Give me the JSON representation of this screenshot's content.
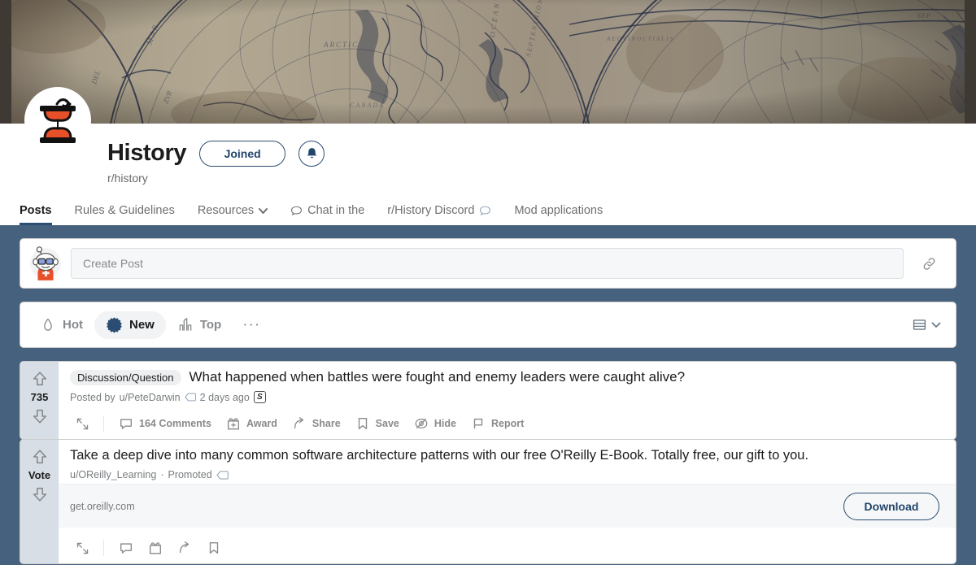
{
  "banner": {
    "alt": "antique world map banner"
  },
  "community": {
    "name": "History",
    "handle": "r/history",
    "join_label": "Joined",
    "notify_icon": "bell-icon",
    "avatar_icon": "hourglass-icon"
  },
  "tabs": [
    {
      "label": "Posts",
      "active": true,
      "icon": ""
    },
    {
      "label": "Rules & Guidelines",
      "active": false,
      "icon": ""
    },
    {
      "label": "Resources",
      "active": false,
      "icon": "chevron-down-icon"
    },
    {
      "label": "Chat in the",
      "active": false,
      "icon": "chat-bubble-icon",
      "icon_leading": true
    },
    {
      "label": "r/History Discord",
      "active": false,
      "icon": "chat-bubble-icon"
    },
    {
      "label": "Mod applications",
      "active": false,
      "icon": ""
    }
  ],
  "create_post": {
    "placeholder": "Create Post",
    "value": "",
    "avatar_icon": "snoo-avatar-icon",
    "attach_icon": "link-icon"
  },
  "sortbar": {
    "options": [
      {
        "label": "Hot",
        "icon": "flame-icon",
        "active": false
      },
      {
        "label": "New",
        "icon": "starburst-icon",
        "active": true
      },
      {
        "label": "Top",
        "icon": "bar-chart-icon",
        "active": false
      }
    ],
    "more_label": "···",
    "view_icon": "card-view-icon",
    "view_chevron": "chevron-down-icon"
  },
  "posts": [
    {
      "vote_count": "735",
      "flair": "Discussion/Question",
      "title": "What happened when battles were fought and enemy leaders were caught alive?",
      "posted_by_prefix": "Posted by",
      "author": "u/PeteDarwin",
      "timestamp": "2 days ago",
      "badge": "S",
      "actions": [
        {
          "label": "164 Comments",
          "icon": "comment-icon"
        },
        {
          "label": "Award",
          "icon": "gift-icon"
        },
        {
          "label": "Share",
          "icon": "share-icon"
        },
        {
          "label": "Save",
          "icon": "bookmark-icon"
        },
        {
          "label": "Hide",
          "icon": "hide-eye-icon"
        },
        {
          "label": "Report",
          "icon": "flag-icon"
        }
      ]
    },
    {
      "vote_count": "Vote",
      "flair": "",
      "title": "Take a deep dive into many common software architecture patterns with our free O'Reilly E-Book. Totally free, our gift to you.",
      "author": "u/OReilly_Learning",
      "separator": "·",
      "promoted_label": "Promoted",
      "promo_tag_icon": "tag-icon",
      "link_url": "get.oreilly.com",
      "cta_label": "Download"
    }
  ],
  "colors": {
    "page_bg": "#46617e",
    "card_bg": "#ffffff",
    "vote_col": "#d7dee5",
    "accent_navy": "#2b4d72",
    "muted_text": "#878a8c",
    "logo_orange": "#e8502a"
  }
}
